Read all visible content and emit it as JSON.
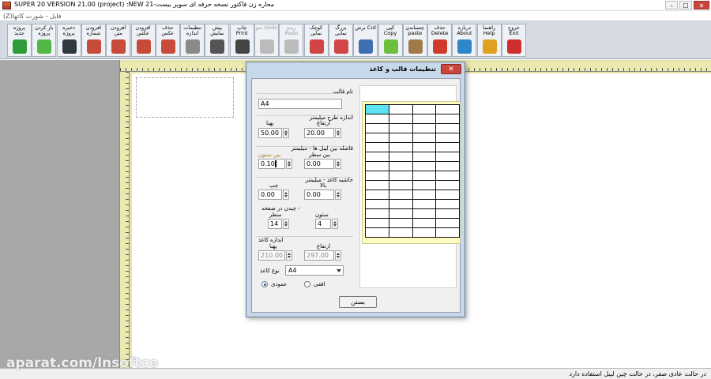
{
  "window": {
    "title": "SUPER 20 VERSION 21.00 (project) :NEW   محاره زن فاکتور نسخه حرفه ای سوپر بیست-21",
    "minimize": "–",
    "maximize": "☐",
    "close": "✕"
  },
  "menu": {
    "text": "(Z)فایل - شورت کاتها"
  },
  "toolbar": {
    "buttons": [
      {
        "label": "پروژه جدید",
        "icon": "refresh-icon",
        "color": "#2e9c3b"
      },
      {
        "label": "باز کردن پروژه",
        "icon": "arrow-right-icon",
        "color": "#52b843"
      },
      {
        "label": "ذخیره پروژه",
        "icon": "floppy-disk-icon",
        "color": "#2f3a40"
      },
      {
        "label": "افزودن شماره",
        "icon": "add-number-icon",
        "color": "#c74b3a"
      },
      {
        "label": "افزودن متن",
        "icon": "add-text-icon",
        "color": "#c74b3a"
      },
      {
        "label": "افزودن عکس",
        "icon": "add-image-icon",
        "color": "#c74b3a"
      },
      {
        "label": "حذف عکس",
        "icon": "delete-image-icon",
        "color": "#c74b3a"
      },
      {
        "label": "تنظیمات اندازه",
        "icon": "gear-icon",
        "color": "#8a8a8a"
      },
      {
        "label": "پیش نمایش",
        "icon": "print-preview-icon",
        "color": "#555"
      },
      {
        "label": "چاپ Print",
        "icon": "printer-icon",
        "color": "#444"
      },
      {
        "label": "ندو Undo",
        "icon": "undo-icon",
        "color": "#bbb",
        "disabled": true
      },
      {
        "label": "ریدو Redo",
        "icon": "redo-icon",
        "color": "#bbb",
        "disabled": true
      },
      {
        "label": "کوچک نمایی",
        "icon": "zoom-out-icon",
        "color": "#d04545"
      },
      {
        "label": "بزرگ نمایی",
        "icon": "zoom-in-icon",
        "color": "#d04545"
      },
      {
        "label": "برش Cut",
        "icon": "scissors-icon",
        "color": "#3e6fb3"
      },
      {
        "label": "کپی Copy",
        "icon": "copy-icon",
        "color": "#6bbf3b"
      },
      {
        "label": "چسباندن paste",
        "icon": "paste-icon",
        "color": "#a07a4a"
      },
      {
        "label": "حذف Delete",
        "icon": "delete-icon",
        "color": "#cf3a2a"
      },
      {
        "label": "درباره About",
        "icon": "globe-icon",
        "color": "#2f86c8"
      },
      {
        "label": "راهنما Help",
        "icon": "help-icon",
        "color": "#e0a020"
      },
      {
        "label": "خروج Exit",
        "icon": "exit-icon",
        "color": "#cf2e2e"
      }
    ]
  },
  "dialog": {
    "title": "تنظیمات قالب و کاغذ",
    "close": "✕",
    "template_name_label": "نام قالب",
    "template_name": "A4",
    "design_size_group": "اندازه طرح میلیمتر",
    "width_label": "پهنا",
    "width": "50.00",
    "height_label": "ارتفاع",
    "height": "20.00",
    "label_spacing_group": "فاصله بین لیبل ها - میلیمتر",
    "col_gap_label": "بین ستون",
    "col_gap": "0.10",
    "row_gap_label": "بین سطر",
    "row_gap": "0.00",
    "margin_group": "حاشیه کاغذ - میلیمتر",
    "left_label": "چپ",
    "left": "0.00",
    "top_label": "بالا",
    "top": "0.00",
    "layout_group": "چیدن در صفحه -",
    "rows_label": "سطر",
    "rows": "14",
    "cols_label": "ستون",
    "cols": "4",
    "paper_size_group": "اندازه کاغذ",
    "paper_width_label": "پهنا",
    "paper_width": "210.00",
    "paper_height_label": "ارتفاع",
    "paper_height": "297.00",
    "paper_type_label": "نوع کاغذ",
    "paper_type": "A4",
    "portrait_label": "عمودی",
    "landscape_label": "افقی",
    "orientation": "portrait",
    "ok": "بستن"
  },
  "status": {
    "text": "در حالت عادی صفر، در حالت چین لیبل استفاده دارد"
  },
  "watermark": "aparat.com/lnsoftco"
}
